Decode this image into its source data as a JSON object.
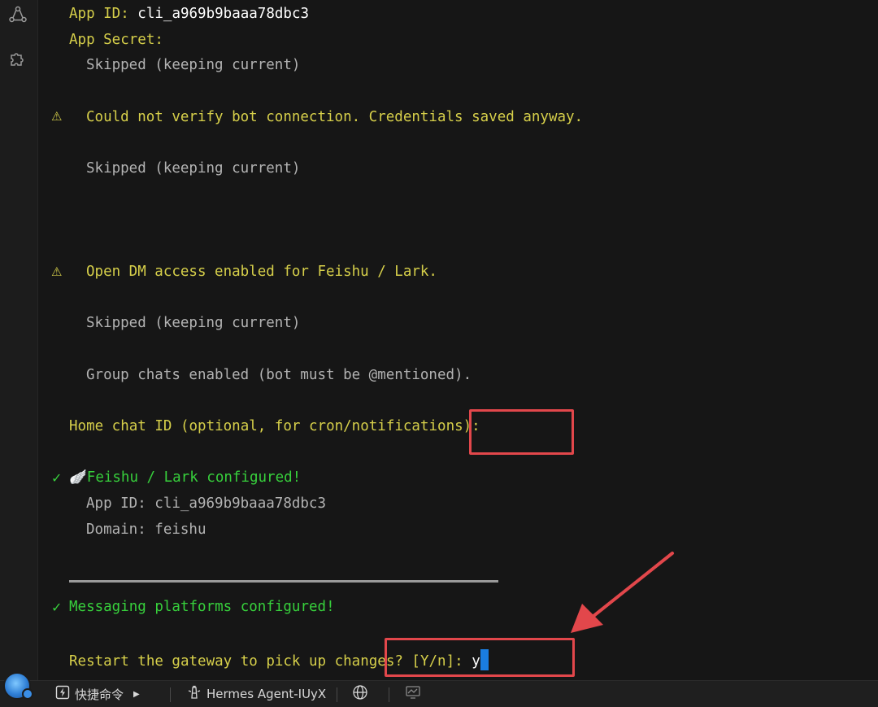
{
  "terminal": {
    "app_id_label": "App ID: ",
    "app_id_value": "cli_a969b9baaa78dbc3",
    "app_secret_label": "App Secret:",
    "skipped_1": "Skipped (keeping current)",
    "warn_glyph": "⚠",
    "warn_verify": "Could not verify bot connection. Credentials saved anyway.",
    "skipped_2": "Skipped (keeping current)",
    "warn_dm": "Open DM access enabled for Feishu / Lark.",
    "skipped_3": "Skipped (keeping current)",
    "group_chats": "Group chats enabled (bot must be @mentioned).",
    "home_chat_prompt": "Home chat ID (optional, for cron/notifications):",
    "check_glyph": "✓",
    "feishu_configured": "🪽Feishu / Lark configured!",
    "detail_app_id": "App ID: cli_a969b9baaa78dbc3",
    "detail_domain": "Domain: feishu",
    "messaging_configured": "Messaging platforms configured!",
    "restart_prompt": "Restart the gateway to pick up changes? [Y/n]: ",
    "restart_input": "y"
  },
  "statusbar": {
    "quick_commands": "快捷命令",
    "session": "Hermes Agent-IUyX"
  },
  "colors": {
    "prompt_yellow": "#d6cf4a",
    "success_green": "#37d03c",
    "muted_gray": "#b3b3b3",
    "highlight_red": "#e2474b",
    "cursor_blue": "#1a7de0"
  },
  "icons": {
    "sidebar_top": "share-network-icon",
    "sidebar_second": "puzzle-plugin-icon",
    "quick_commands": "lightning-icon",
    "session": "lighthouse-icon",
    "globe": "globe-icon",
    "monitor": "monitor-chart-icon",
    "arrow": "annotation-arrow"
  }
}
